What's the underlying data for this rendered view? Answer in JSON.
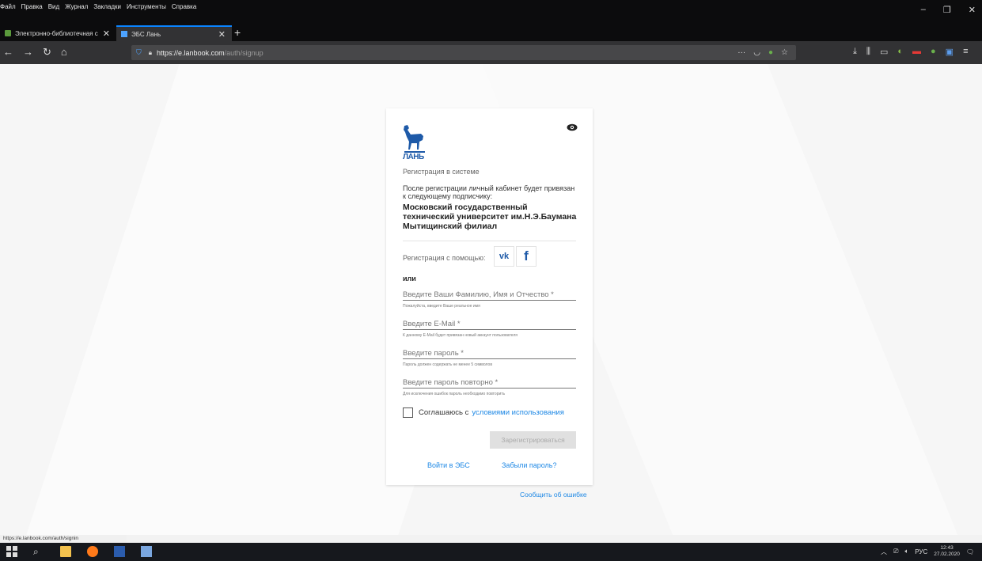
{
  "browser": {
    "menu_items": [
      "Файл",
      "Правка",
      "Вид",
      "Журнал",
      "Закладки",
      "Инструменты",
      "Справка"
    ],
    "tabs": [
      {
        "title": "Электронно-библиотечная с"
      },
      {
        "title": "ЭБС Лань"
      }
    ],
    "url": {
      "host": "https://e.lanbook.com",
      "path": "/auth/signup"
    },
    "status_url": "https://e.lanbook.com/auth/signin"
  },
  "form": {
    "logo_text": "ЛАНЬ",
    "subtitle": "Регистрация в системе",
    "note": "После регистрации личный кабинет будет привязан к следующему подписчику:",
    "organization": "Московский государственный технический университет им.Н.Э.Баумана Мытищинский филиал",
    "social_label": "Регистрация с помощью:",
    "vk_label": "vk",
    "fb_label": "f",
    "or_label": "или",
    "fields": [
      {
        "placeholder": "Введите Ваши Фамилию, Имя и Отчество *",
        "hint": "Пожалуйста, введите Ваше реальное имя"
      },
      {
        "placeholder": "Введите E-Mail *",
        "hint": "К данному E-Mail будет привязан новый аккаунт пользователя"
      },
      {
        "placeholder": "Введите пароль *",
        "hint": "Пароль должен содержать не менее 5 символов"
      },
      {
        "placeholder": "Введите пароль повторно *",
        "hint": "Для исключения ошибок пароль необходимо повторить"
      }
    ],
    "agree_text": "Соглашаюсь с",
    "agree_link": "условиями использования",
    "submit_label": "Зарегистрироваться",
    "login_link": "Войти в ЭБС",
    "forgot_link": "Забыли пароль?"
  },
  "report_link": "Сообщить об ошибке",
  "taskbar": {
    "lang": "РУС",
    "time": "12:43",
    "date": "27.02.2020"
  },
  "colors": {
    "accent": "#1e88e5",
    "brand": "#1e5aa8"
  }
}
